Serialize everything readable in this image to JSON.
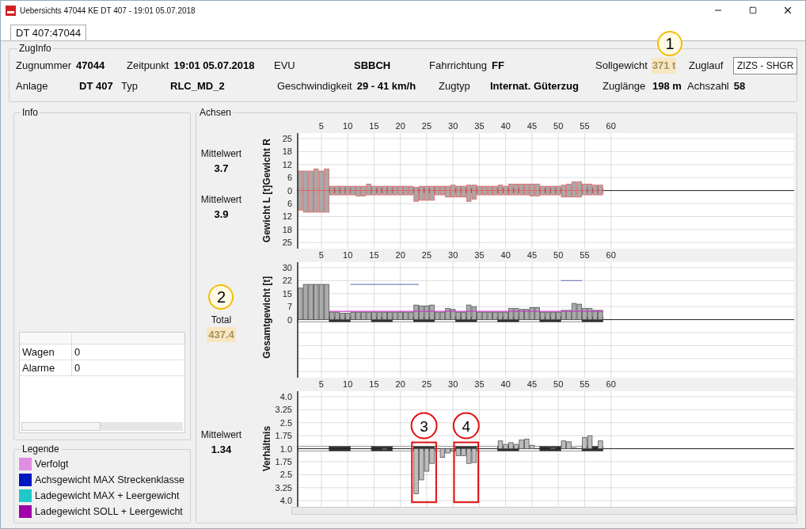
{
  "window": {
    "title": "Uebersichts 47044 KE DT 407 - 19:01 05.07.2018"
  },
  "tabs": [
    {
      "label": "DT 407:47044",
      "selected": true
    }
  ],
  "zuginfo": {
    "title": "ZugInfo",
    "rows": [
      [
        {
          "label": "Zugnummer",
          "value": "47044",
          "kind": "text"
        },
        {
          "label": "Zeitpunkt",
          "value": "19:01 05.07.2018",
          "kind": "text"
        },
        {
          "label": "EVU",
          "value": "SBBCH",
          "kind": "text"
        },
        {
          "label": "Fahrrichtung",
          "value": "FF",
          "kind": "text"
        },
        {
          "label": "Sollgewicht",
          "value": "371 t",
          "kind": "text",
          "highlighted": true,
          "callout": "1"
        },
        {
          "label": "Zuglauf",
          "value": "ZIZS - SHGR",
          "kind": "box"
        }
      ],
      [
        {
          "label": "Anlage",
          "value": "DT 407",
          "kind": "text"
        },
        {
          "label": "Typ",
          "value": "RLC_MD_2",
          "kind": "text"
        },
        {
          "label": "Geschwindigkeit",
          "value": "29 - 41 km/h",
          "kind": "text"
        },
        {
          "label": "Zugtyp",
          "value": "Internat. Güterzug",
          "kind": "text"
        },
        {
          "label": "Zuglänge",
          "value": "198 m",
          "kind": "text"
        },
        {
          "label": "Achszahl",
          "value": "58",
          "kind": "text"
        }
      ]
    ]
  },
  "info": {
    "title": "Info",
    "rows": [
      {
        "label": "Wagen",
        "value": "0"
      },
      {
        "label": "Alarme",
        "value": "0"
      }
    ]
  },
  "legend": {
    "title": "Legende",
    "items": [
      {
        "label": "Verfolgt",
        "color": "#e08ee0"
      },
      {
        "label": "Achsgewicht MAX Streckenklasse",
        "color": "#0018c0"
      },
      {
        "label": "Ladegewicht MAX + Leergewicht",
        "color": "#20c8c8"
      },
      {
        "label": "Ladegewicht SOLL + Leergewicht",
        "color": "#a000a8"
      }
    ]
  },
  "achsen": {
    "title": "Achsen",
    "panels": [
      {
        "stats": [
          {
            "label": "Mittelwert",
            "value": "3.7"
          },
          {
            "label": "Mittelwert",
            "value": "3.9"
          }
        ],
        "ylabel": "Gewicht L [t]Gewicht R",
        "xticks": [
          "5",
          "10",
          "15",
          "20",
          "25",
          "30",
          "35",
          "40",
          "45",
          "50",
          "55",
          "60"
        ],
        "yticks": [
          "25",
          "18",
          "12",
          "6",
          "0",
          "6",
          "12",
          "18",
          "25"
        ]
      },
      {
        "stats": [
          {
            "label": "Total",
            "value": "437.4",
            "highlighted": true,
            "callout": "2"
          }
        ],
        "ylabel": "Gesamtgewicht [t]",
        "xticks": [
          "5",
          "10",
          "15",
          "20",
          "25",
          "30",
          "35",
          "40",
          "45",
          "50",
          "55",
          "60"
        ],
        "yticks": [
          "30",
          "22",
          "15",
          "7",
          "0"
        ]
      },
      {
        "stats": [
          {
            "label": "Mittelwert",
            "value": "1.34"
          }
        ],
        "ylabel": "Verhältnis",
        "xticks": [
          "5",
          "10",
          "15",
          "20",
          "25",
          "30",
          "35",
          "40",
          "45",
          "50",
          "55",
          "60"
        ],
        "yticks": [
          "4.0",
          "3.25",
          "2.5",
          "1.75",
          "1.0",
          "1.75",
          "2.5",
          "3.25",
          "4.0"
        ],
        "callouts": [
          {
            "label": "3"
          },
          {
            "label": "4"
          }
        ]
      }
    ]
  }
}
